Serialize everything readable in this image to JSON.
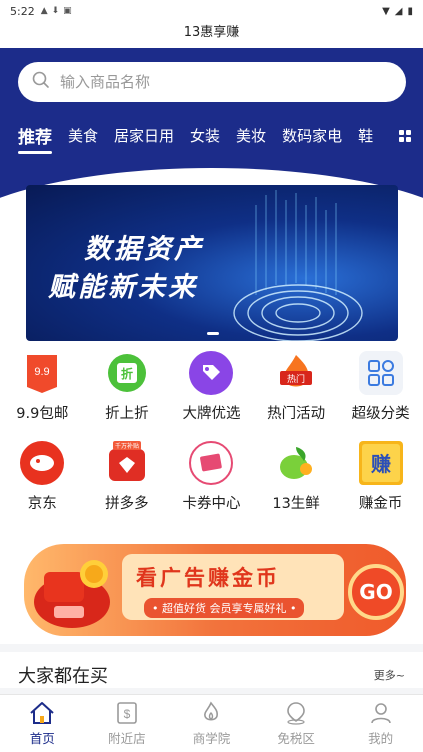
{
  "status": {
    "time": "5:22"
  },
  "window": {
    "title": "13惠享赚"
  },
  "search": {
    "placeholder": "输入商品名称"
  },
  "categories": [
    {
      "label": "推荐"
    },
    {
      "label": "美食"
    },
    {
      "label": "居家日用"
    },
    {
      "label": "女装"
    },
    {
      "label": "美妆"
    },
    {
      "label": "数码家电"
    },
    {
      "label": "鞋"
    }
  ],
  "banner": {
    "line1": "数据资产",
    "line2": "赋能新未来"
  },
  "grid": [
    {
      "label": "9.9包邮",
      "icon": "tag-9-9-icon",
      "badge": "9.9"
    },
    {
      "label": "折上折",
      "icon": "discount-icon",
      "badge": "折"
    },
    {
      "label": "大牌优选",
      "icon": "brand-tag-icon"
    },
    {
      "label": "热门活动",
      "icon": "hot-icon",
      "badge": "热门"
    },
    {
      "label": "超级分类",
      "icon": "category-grid-icon"
    },
    {
      "label": "京东",
      "icon": "jd-icon"
    },
    {
      "label": "拼多多",
      "icon": "pdd-icon",
      "badge": "千万补贴"
    },
    {
      "label": "卡券中心",
      "icon": "coupon-icon"
    },
    {
      "label": "13生鲜",
      "icon": "fresh-icon"
    },
    {
      "label": "赚金币",
      "icon": "earn-coin-icon",
      "badge": "赚"
    }
  ],
  "ad": {
    "title": "看广告赚金币",
    "subtitle": "• 超值好货 会员享专属好礼 •",
    "go": "GO"
  },
  "section": {
    "title": "大家都在买",
    "more": "更多~"
  },
  "tabs": [
    {
      "label": "首页",
      "icon": "home-icon"
    },
    {
      "label": "附近店",
      "icon": "store-icon"
    },
    {
      "label": "商学院",
      "icon": "flame-icon"
    },
    {
      "label": "免税区",
      "icon": "location-icon"
    },
    {
      "label": "我的",
      "icon": "user-icon"
    }
  ],
  "colors": {
    "primary": "#1c2c8a",
    "accent": "#ef4a27"
  }
}
